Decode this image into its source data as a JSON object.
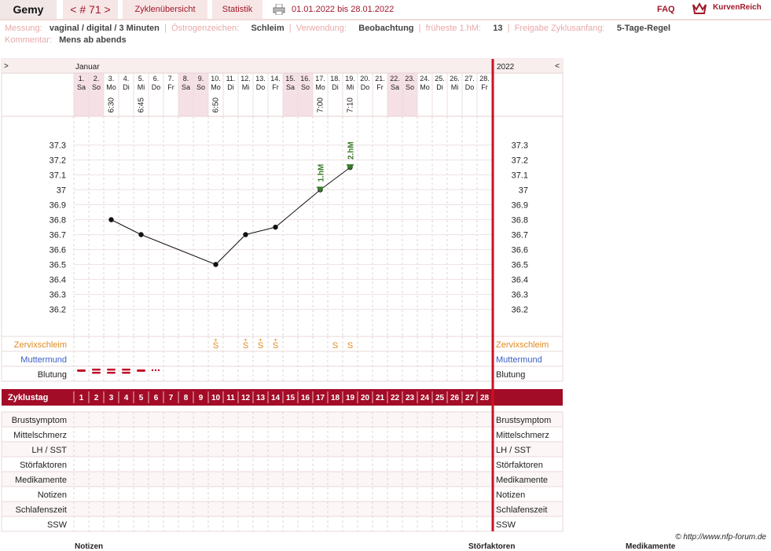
{
  "nav": {
    "name": "Gemy",
    "cycle": "< # 71 >",
    "overview": "Zyklenübersicht",
    "stats": "Statistik",
    "date_range": "01.01.2022 bis 28.01.2022",
    "faq": "FAQ",
    "logo": "KurvenReich"
  },
  "meta": {
    "messung_label": "Messung:",
    "messung_value": "vaginal / digital / 3 Minuten",
    "oestrogen_label": "Östrogenzeichen:",
    "oestrogen_value": "Schleim",
    "verwendung_label": "Verwendung:",
    "verwendung_value": "Beobachtung",
    "frueheste_label": "früheste 1.hM:",
    "frueheste_value": "13",
    "freigabe_label": "Freigabe Zyklusanfang:",
    "freigabe_value": "5-Tage-Regel",
    "kommentar_label": "Kommentar:",
    "kommentar_value": "Mens ab abends",
    "separator": "|"
  },
  "chart_data": {
    "type": "line",
    "month_label": "Januar",
    "year_label": "2022",
    "nav_left": ">",
    "nav_right": "<",
    "dates": [
      "1.",
      "2.",
      "3.",
      "4.",
      "5.",
      "6.",
      "7.",
      "8.",
      "9.",
      "10.",
      "11.",
      "12.",
      "13.",
      "14.",
      "15.",
      "16.",
      "17.",
      "18.",
      "19.",
      "20.",
      "21.",
      "22.",
      "23.",
      "24.",
      "25.",
      "26.",
      "27.",
      "28."
    ],
    "weekdays": [
      "Sa",
      "So",
      "Mo",
      "Di",
      "Mi",
      "Do",
      "Fr",
      "Sa",
      "So",
      "Mo",
      "Di",
      "Mi",
      "Do",
      "Fr",
      "Sa",
      "So",
      "Mo",
      "Di",
      "Mi",
      "Do",
      "Fr",
      "Sa",
      "So",
      "Mo",
      "Di",
      "Mi",
      "Do",
      "Fr"
    ],
    "weekend_days": [
      1,
      2,
      8,
      9,
      15,
      16,
      22,
      23
    ],
    "times": {
      "3": "6:30",
      "5": "6:45",
      "10": "6:50",
      "17": "7:00",
      "19": "7:10"
    },
    "y_ticks": [
      37.3,
      37.2,
      37.1,
      37.0,
      36.9,
      36.8,
      36.7,
      36.6,
      36.5,
      36.4,
      36.3,
      36.2
    ],
    "y_tick_labels": [
      "37.3",
      "37.2",
      "37.1",
      "37",
      "36.9",
      "36.8",
      "36.7",
      "36.6",
      "36.5",
      "36.4",
      "36.3",
      "36.2"
    ],
    "ylim": [
      36.2,
      37.3
    ],
    "series": [
      {
        "points": [
          {
            "day": 3,
            "temp": 36.8
          },
          {
            "day": 5,
            "temp": 36.7
          },
          {
            "day": 10,
            "temp": 36.5
          },
          {
            "day": 12,
            "temp": 36.7
          },
          {
            "day": 14,
            "temp": 36.75
          },
          {
            "day": 17,
            "temp": 37.0
          },
          {
            "day": 19,
            "temp": 37.15
          }
        ]
      }
    ],
    "markers": [
      {
        "day": 17,
        "label": "1.hM",
        "color": "#3a7a2a"
      },
      {
        "day": 19,
        "label": "2.hM",
        "color": "#3a7a2a"
      }
    ],
    "cervix_symbols": [
      {
        "day": 10,
        "symbol": "S+"
      },
      {
        "day": 12,
        "symbol": "S+"
      },
      {
        "day": 13,
        "symbol": "S+"
      },
      {
        "day": 14,
        "symbol": "S+"
      },
      {
        "day": 18,
        "symbol": "S"
      },
      {
        "day": 19,
        "symbol": "S"
      }
    ],
    "bleeding": [
      {
        "day": 1,
        "kind": "heavy"
      },
      {
        "day": 2,
        "kind": "medium"
      },
      {
        "day": 3,
        "kind": "medium"
      },
      {
        "day": 4,
        "kind": "medium"
      },
      {
        "day": 5,
        "kind": "heavy"
      },
      {
        "day": 6,
        "kind": "spotting"
      }
    ],
    "cycle_days": [
      "1",
      "2",
      "3",
      "4",
      "5",
      "6",
      "7",
      "8",
      "9",
      "10",
      "11",
      "12",
      "13",
      "14",
      "15",
      "16",
      "17",
      "18",
      "19",
      "20",
      "21",
      "22",
      "23",
      "24",
      "25",
      "26",
      "27",
      "28"
    ],
    "colors": {
      "accent": "#a30c27",
      "cervix": "#e08a1e",
      "muttermund": "#3a5ec8",
      "bleeding": "#c0102a",
      "weekend": "#f5e1e5",
      "marker": "#3a7a2a"
    }
  },
  "rows": {
    "zervix": "Zervixschleim",
    "muttermund": "Muttermund",
    "blutung": "Blutung",
    "zyklustag": "Zyklustag",
    "lower": [
      "Brustsymptom",
      "Mittelschmerz",
      "LH / SST",
      "Störfaktoren",
      "Medikamente",
      "Notizen",
      "Schlafenszeit",
      "SSW"
    ]
  },
  "credit": "© http://www.nfp-forum.de",
  "footer": {
    "notizen": "Notizen",
    "stoerfaktoren": "Störfaktoren",
    "medikamente": "Medikamente"
  }
}
